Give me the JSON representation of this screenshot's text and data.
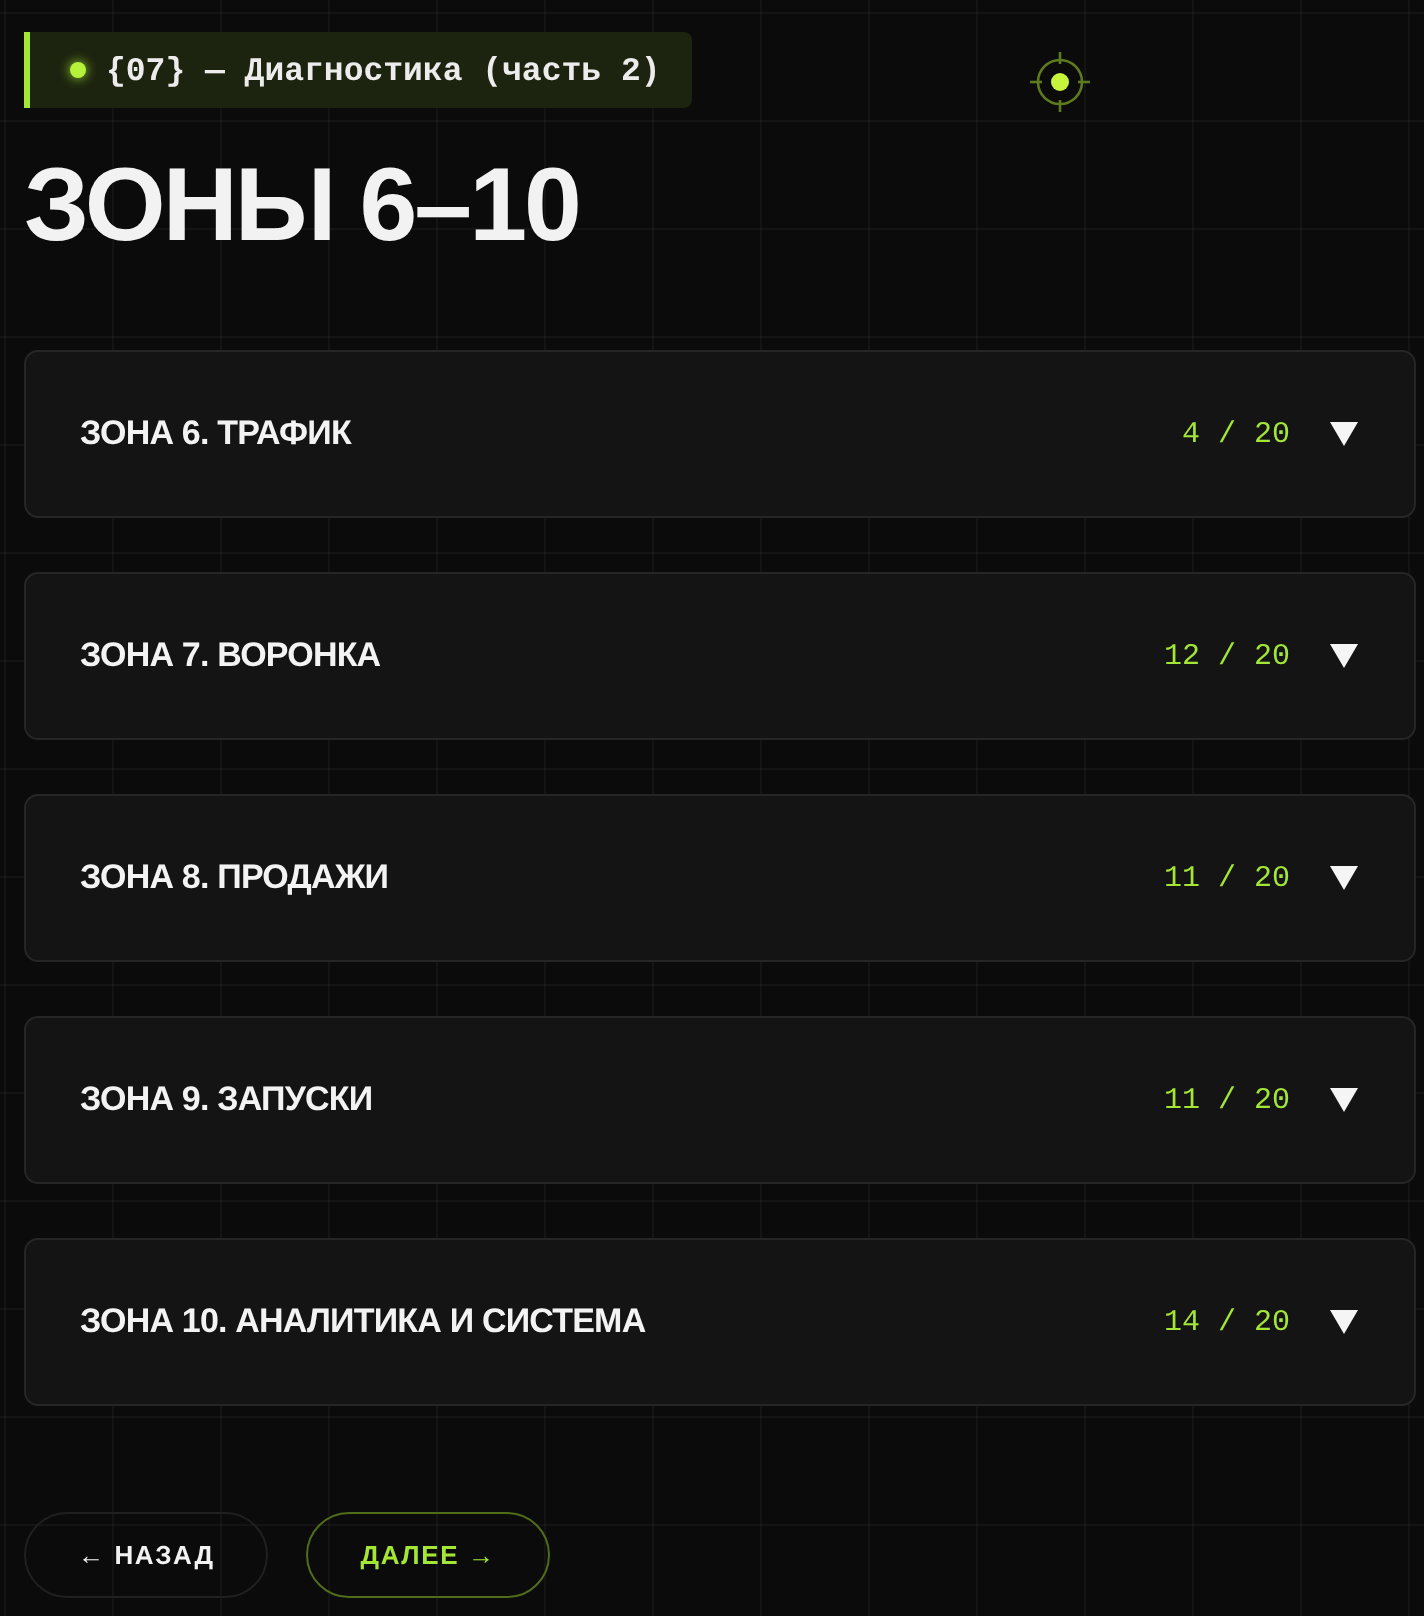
{
  "badge": {
    "text": "{07} — Диагностика (часть 2)"
  },
  "title": "ЗОНЫ 6–10",
  "zones": [
    {
      "title": "ЗОНА 6. ТРАФИК",
      "score": "4 / 20",
      "expanded": false
    },
    {
      "title": "ЗОНА 7. ВОРОНКА",
      "score": "12 / 20",
      "expanded": false
    },
    {
      "title": "ЗОНА 8. ПРОДАЖИ",
      "score": "11 / 20",
      "expanded": false
    },
    {
      "title": "ЗОНА 9. ЗАПУСКИ",
      "score": "11 / 20",
      "expanded": false
    },
    {
      "title": "ЗОНА 10. АНАЛИТИКА И СИСТЕМА",
      "score": "14 / 20",
      "expanded": false
    }
  ],
  "nav": [
    {
      "label": "← НАЗАД",
      "kind": "back"
    },
    {
      "label": "ДАЛЕЕ →",
      "kind": "next"
    }
  ]
}
